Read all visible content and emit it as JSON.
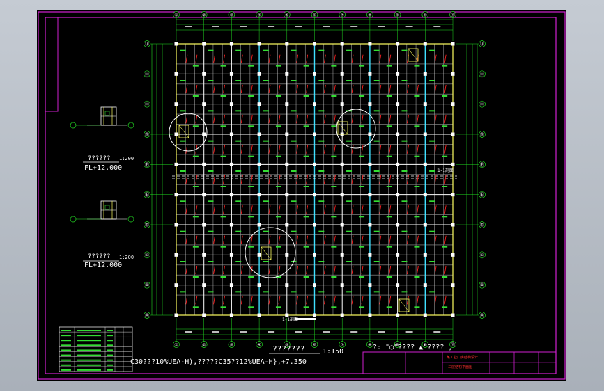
{
  "colors": {
    "background": "#b8bec6",
    "paper": "#000000",
    "frame": "#d020d0",
    "grid": "#ffffff",
    "beam": "#ffffff",
    "column": "#ffffff",
    "highlight_beam": "#40e0ff",
    "rebar": "#ff2020",
    "dims": "#22dd22",
    "text": "#ffffff",
    "axis_bubble": "#22dd22"
  },
  "plan": {
    "axis_columns": [
      "①",
      "②",
      "③",
      "④",
      "⑤",
      "⑥",
      "⑦",
      "⑧",
      "⑨",
      "⑩",
      "⑪"
    ],
    "axis_rows": [
      "Ⓐ",
      "Ⓑ",
      "Ⓒ",
      "Ⓓ",
      "Ⓔ",
      "Ⓕ",
      "Ⓖ",
      "Ⓗ",
      "Ⓘ",
      "Ⓙ"
    ],
    "section_mark_top": "1-1剖面",
    "section_mark_bottom": "1-1剖面",
    "main_title": "???????",
    "main_scale": "1:150",
    "note_line": "C30???10%UEA-H),?????C35??12%UEA-H},+7.350",
    "legend_note": "?: \"○\"????  ▲\"????  ,"
  },
  "details": [
    {
      "title": "??????",
      "level": "FL+12.000",
      "scale": "1:200"
    },
    {
      "title": "??????",
      "level": "FL+12.000",
      "scale": "1:200"
    }
  ],
  "title_block": {
    "project_line1": "某工业厂房结构设计",
    "project_line2": "二层结构平面图"
  }
}
